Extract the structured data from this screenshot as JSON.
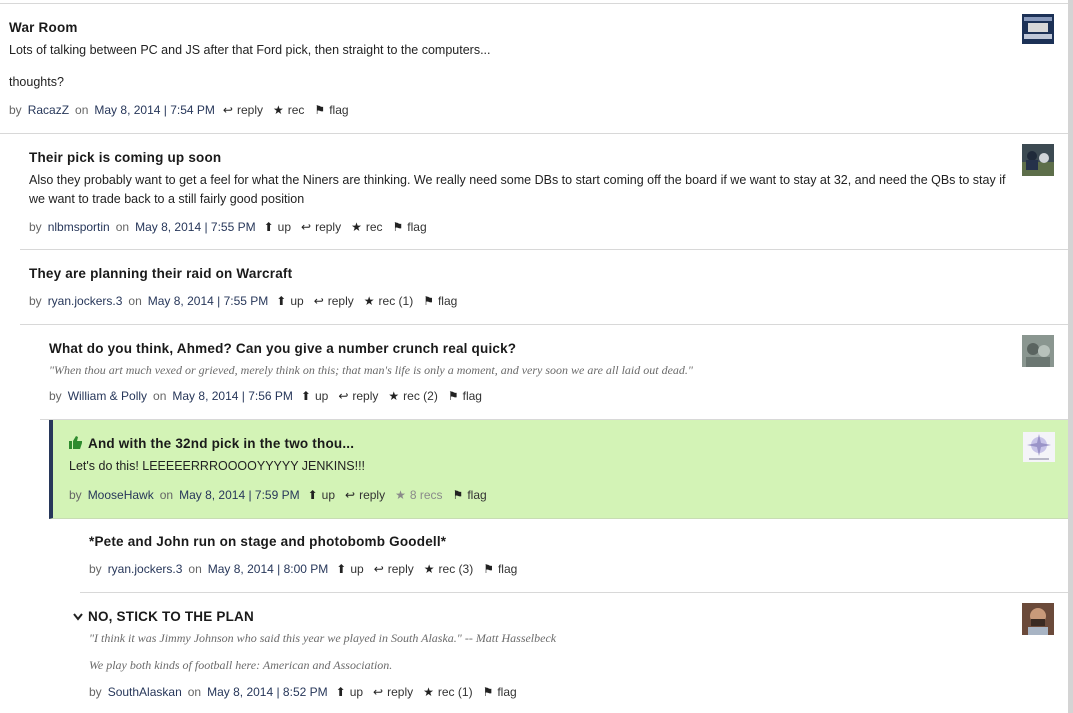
{
  "comments": [
    {
      "title": "War Room",
      "body": "Lots of talking between PC and JS after that Ford pick, then straight to the computers...",
      "body2": "thoughts?",
      "by": "by",
      "author": "RacazZ",
      "on": "on",
      "date": "May 8, 2014 | 7:54 PM",
      "reply": "reply",
      "rec": "rec",
      "flag": "flag",
      "avatar_colors": [
        "#1c3156",
        "#f2f2f2"
      ]
    },
    {
      "title": "Their pick is coming up soon",
      "body": "Also they probably want to get a feel for what the Niners are thinking. We really need some DBs to start coming off the board if we want to stay at 32, and need the QBs to stay if we want to trade back to a still fairly good position",
      "by": "by",
      "author": "nlbmsportin",
      "on": "on",
      "date": "May 8, 2014 | 7:55 PM",
      "up": "up",
      "reply": "reply",
      "rec": "rec",
      "flag": "flag"
    },
    {
      "title": "They are planning their raid on Warcraft",
      "by": "by",
      "author": "ryan.jockers.3",
      "on": "on",
      "date": "May 8, 2014 | 7:55 PM",
      "up": "up",
      "reply": "reply",
      "rec": "rec (1)",
      "flag": "flag"
    },
    {
      "title": "What do you think, Ahmed? Can you give a number crunch real quick?",
      "quote": "\"When thou art much vexed or grieved, merely think on this; that man's life is only a moment, and very soon we are all laid out dead.\"",
      "by": "by",
      "author": "William & Polly",
      "on": "on",
      "date": "May 8, 2014 | 7:56 PM",
      "up": "up",
      "reply": "reply",
      "rec": "rec (2)",
      "flag": "flag"
    },
    {
      "title": "And with the 32nd pick in the two thou...",
      "body": "Let's do this! LEEEEERRROOOOYYYYY JENKINS!!!",
      "by": "by",
      "author": "MooseHawk",
      "on": "on",
      "date": "May 8, 2014 | 7:59 PM",
      "up": "up",
      "reply": "reply",
      "rec": "8 recs",
      "flag": "flag",
      "highlight_color": "#d3f3b6"
    },
    {
      "title": "*Pete and John run on stage and photobomb Goodell*",
      "by": "by",
      "author": "ryan.jockers.3",
      "on": "on",
      "date": "May 8, 2014 | 8:00 PM",
      "up": "up",
      "reply": "reply",
      "rec": "rec (3)",
      "flag": "flag"
    },
    {
      "title": "NO, STICK TO THE PLAN",
      "quote": "\"I think it was Jimmy Johnson who said this year we played in South Alaska.\" -- Matt Hasselbeck",
      "quote2": "We play both kinds of football here: American and Association.",
      "by": "by",
      "author": "SouthAlaskan",
      "on": "on",
      "date": "May 8, 2014 | 8:52 PM",
      "up": "up",
      "reply": "reply",
      "rec": "rec (1)",
      "flag": "flag"
    }
  ],
  "icons": {
    "reply": "reply-arrow-icon",
    "rec": "star-icon",
    "flag": "flag-icon",
    "up": "up-arrow-icon",
    "thumbs": "thumbs-up-icon",
    "collapse": "chevron-down-icon"
  }
}
